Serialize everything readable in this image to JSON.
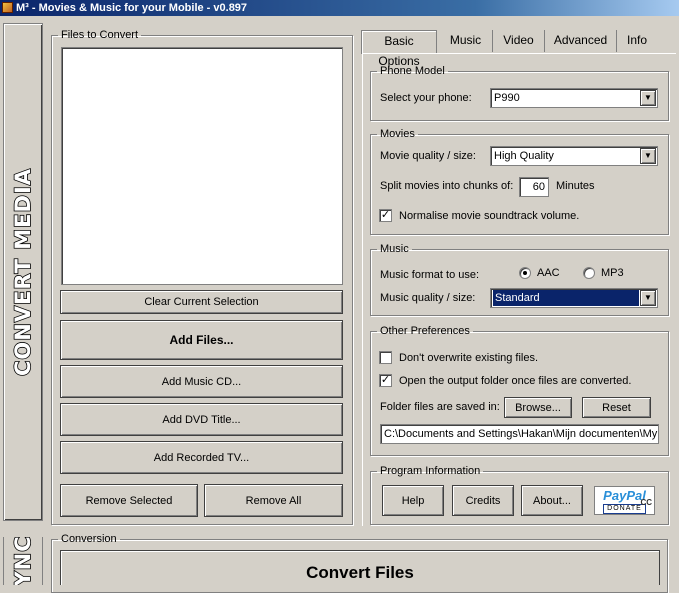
{
  "window": {
    "title": "M³ - Movies & Music for your Mobile - v0.897"
  },
  "sidebar": {
    "convert_media_label": "CONVERT MEDIA",
    "sync_label": "SYNC"
  },
  "files": {
    "group_label": "Files to Convert",
    "items": [],
    "buttons": {
      "clear": "Clear Current Selection",
      "add_files": "Add Files...",
      "add_music_cd": "Add Music CD...",
      "add_dvd_title": "Add DVD Title...",
      "add_recorded_tv": "Add Recorded TV...",
      "remove_selected": "Remove Selected",
      "remove_all": "Remove All"
    }
  },
  "tabs": [
    {
      "label": "Basic Options",
      "active": true
    },
    {
      "label": "Music",
      "active": false
    },
    {
      "label": "Video",
      "active": false
    },
    {
      "label": "Advanced",
      "active": false
    },
    {
      "label": "Info",
      "active": false
    }
  ],
  "phone_model": {
    "group_label": "Phone Model",
    "select_label": "Select your phone:",
    "value": "P990"
  },
  "movies": {
    "group_label": "Movies",
    "quality_label": "Movie quality / size:",
    "quality_value": "High Quality",
    "split_label": "Split movies into chunks of:",
    "split_value": "60",
    "split_unit": "Minutes",
    "normalise_label": "Normalise movie soundtrack volume.",
    "normalise_checked": true
  },
  "music": {
    "group_label": "Music",
    "format_label": "Music format to use:",
    "format_options": [
      "AAC",
      "MP3"
    ],
    "format_selected": "AAC",
    "quality_label": "Music quality / size:",
    "quality_value": "Standard"
  },
  "other_prefs": {
    "group_label": "Other Preferences",
    "dont_overwrite_label": "Don't overwrite existing files.",
    "dont_overwrite_checked": false,
    "open_folder_label": "Open the output folder once files are converted.",
    "open_folder_checked": true,
    "folder_label": "Folder files are saved in:",
    "browse_label": "Browse...",
    "reset_label": "Reset",
    "folder_path": "C:\\Documents and Settings\\Hakan\\Mijn documenten\\My"
  },
  "program_info": {
    "group_label": "Program Information",
    "help_label": "Help",
    "credits_label": "Credits",
    "about_label": "About...",
    "paypal": {
      "word_pay": "Pay",
      "word_pal": "Pal",
      "donate": "DONATE",
      "cc": "CC"
    }
  },
  "conversion": {
    "group_label": "Conversion",
    "convert_label": "Convert Files"
  },
  "colors": {
    "face": "#d4d0c8",
    "highlight": "#0a246a",
    "title_start": "#0a246a",
    "title_end": "#a6caf0"
  }
}
